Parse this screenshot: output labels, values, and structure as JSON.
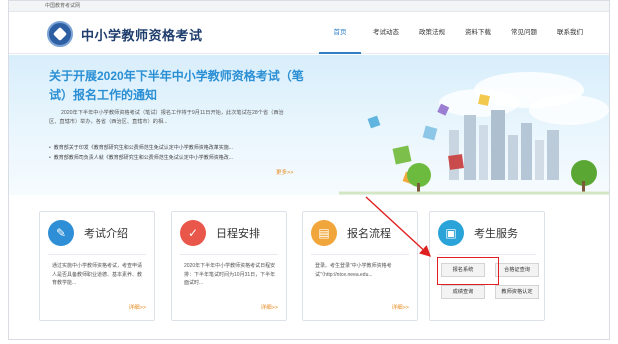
{
  "topbar": {
    "site_label": "中国教育考试网"
  },
  "header": {
    "logo_text": "中小学教师资格考试",
    "nav": [
      {
        "label": "首页",
        "active": true
      },
      {
        "label": "考试动态",
        "active": false
      },
      {
        "label": "政策法规",
        "active": false
      },
      {
        "label": "资料下载",
        "active": false
      },
      {
        "label": "常见问题",
        "active": false
      },
      {
        "label": "联系我们",
        "active": false
      }
    ]
  },
  "banner": {
    "title": "关于开展2020年下半年中小学教师资格考试（笔试）报名工作的通知",
    "body": "2020年下半年中小学教师资格考试（笔试）报名工作将于9月11日开始，此次笔试在28个省（西治区、直辖市）举办，各省（西治区、直辖市）的相...",
    "links": [
      "教育部关于印发《教育部研究生和公费师范生免试认定中小学教师资格改革实施...",
      "教育部教师司负责人就《教育部研究生和公费师范生免试认定中小学教师资格改..."
    ],
    "more": "更多>>"
  },
  "cards": [
    {
      "title": "考试介绍",
      "icon": "pencil-note-icon",
      "body": "通过实施中小学教师资格考试，考查申请人是否具备教师职业道德、基本素养、教育教学能...",
      "more": "详细>>"
    },
    {
      "title": "日程安排",
      "icon": "checkmark-icon",
      "body": "2020年下半年中小学教师资格考试日程安排：下半年笔试时间为10月31日，下半年面试时...",
      "more": "详细>>"
    },
    {
      "title": "报名流程",
      "icon": "folder-icon",
      "body": "登录。考生登录“中小学教师资格考试”（http://ntce.neea.edu...",
      "more": "详细>>"
    },
    {
      "title": "考生服务",
      "icon": "user-card-icon",
      "buttons": [
        "报名系统",
        "合格证查询",
        "成绩查询",
        "教师资格认定"
      ]
    }
  ],
  "colors": {
    "accent": "#2e7fc6",
    "highlight": "#e02020",
    "more_link": "#e68a1f"
  }
}
